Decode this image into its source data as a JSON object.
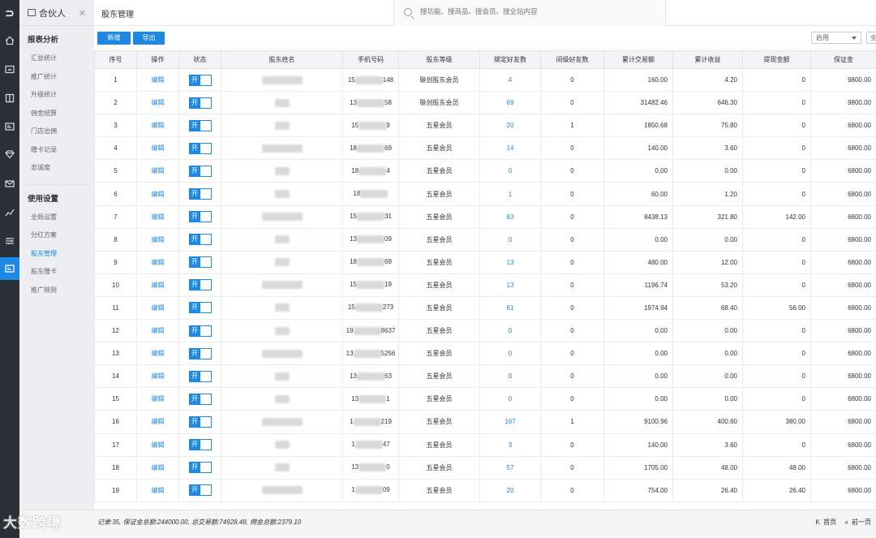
{
  "app": {
    "module_title": "合伙人",
    "page_title": "股东管理"
  },
  "rail_icons": [
    "home-icon",
    "monitor-icon",
    "book-icon",
    "id-card-icon",
    "diamond-icon",
    "mail-icon",
    "trend-icon",
    "sliders-icon",
    "card-icon"
  ],
  "sidenav": {
    "group1": "报表分析",
    "group1_items": [
      "汇总统计",
      "推广统计",
      "升级统计",
      "佣金结算",
      "门店出佣",
      "赠卡记录",
      "忠诚度"
    ],
    "group2": "使用设置",
    "group2_items": [
      "全局设置",
      "分红方案",
      "股东管理",
      "股东赠卡",
      "推广规则"
    ],
    "active_item": "股东管理"
  },
  "search": {
    "placeholder": "搜功能、搜商品、搜会员、搜全站内容"
  },
  "toolbar": {
    "add_label": "新增",
    "export_label": "导出",
    "status_filter": "启用",
    "second_filter": "全"
  },
  "table": {
    "headers": [
      "序号",
      "操作",
      "状态",
      "股东姓名",
      "手机号码",
      "股东等级",
      "绑定好友数",
      "间级好友数",
      "累计交易额",
      "累计收益",
      "提现金额",
      "保证金"
    ],
    "edit_label": "编辑",
    "toggle_label": "开",
    "rows": [
      {
        "no": "1",
        "name": "",
        "phone_a": "15",
        "phone_b": "148",
        "level": "联创股东会员",
        "bound": "4",
        "indirect": "0",
        "trade": "160.00",
        "income": "4.20",
        "withdraw": "0",
        "deposit": "9800.00"
      },
      {
        "no": "2",
        "name": "",
        "phone_a": "13",
        "phone_b": "58",
        "level": "联创股东会员",
        "bound": "69",
        "indirect": "0",
        "trade": "31482.46",
        "income": "646.30",
        "withdraw": "0",
        "deposit": "9800.00"
      },
      {
        "no": "3",
        "name": "",
        "phone_a": "15",
        "phone_b": "9",
        "level": "五星会员",
        "bound": "20",
        "indirect": "1",
        "trade": "1850.68",
        "income": "75.80",
        "withdraw": "0",
        "deposit": "6800.00"
      },
      {
        "no": "4",
        "name": "",
        "phone_a": "18",
        "phone_b": "69",
        "level": "五星会员",
        "bound": "14",
        "indirect": "0",
        "trade": "140.00",
        "income": "3.60",
        "withdraw": "0",
        "deposit": "6800.00"
      },
      {
        "no": "5",
        "name": "",
        "phone_a": "18",
        "phone_b": "4",
        "level": "五星会员",
        "bound": "0",
        "indirect": "0",
        "trade": "0.00",
        "income": "0.00",
        "withdraw": "0",
        "deposit": "6800.00"
      },
      {
        "no": "6",
        "name": "",
        "phone_a": "18",
        "phone_b": "",
        "level": "五星会员",
        "bound": "1",
        "indirect": "0",
        "trade": "60.00",
        "income": "1.20",
        "withdraw": "0",
        "deposit": "6800.00"
      },
      {
        "no": "7",
        "name": "",
        "phone_a": "15",
        "phone_b": "31",
        "level": "五星会员",
        "bound": "83",
        "indirect": "0",
        "trade": "8438.13",
        "income": "321.80",
        "withdraw": "142.00",
        "deposit": "6800.00"
      },
      {
        "no": "8",
        "name": "",
        "phone_a": "13",
        "phone_b": "09",
        "level": "五星会员",
        "bound": "0",
        "indirect": "0",
        "trade": "0.00",
        "income": "0.00",
        "withdraw": "0",
        "deposit": "6800.00"
      },
      {
        "no": "9",
        "name": "",
        "phone_a": "18",
        "phone_b": "69",
        "level": "五星会员",
        "bound": "13",
        "indirect": "0",
        "trade": "480.00",
        "income": "12.00",
        "withdraw": "0",
        "deposit": "6800.00"
      },
      {
        "no": "10",
        "name": "",
        "phone_a": "15",
        "phone_b": "19",
        "level": "五星会员",
        "bound": "13",
        "indirect": "0",
        "trade": "1196.74",
        "income": "53.20",
        "withdraw": "0",
        "deposit": "6800.00"
      },
      {
        "no": "11",
        "name": "",
        "phone_a": "15",
        "phone_b": "273",
        "level": "五星会员",
        "bound": "61",
        "indirect": "0",
        "trade": "1974.94",
        "income": "68.40",
        "withdraw": "56.00",
        "deposit": "6800.00"
      },
      {
        "no": "12",
        "name": "",
        "phone_a": "19",
        "phone_b": "8637",
        "level": "五星会员",
        "bound": "0",
        "indirect": "0",
        "trade": "0.00",
        "income": "0.00",
        "withdraw": "0",
        "deposit": "6800.00"
      },
      {
        "no": "13",
        "name": "",
        "phone_a": "13",
        "phone_b": "5256",
        "level": "五星会员",
        "bound": "0",
        "indirect": "0",
        "trade": "0.00",
        "income": "0.00",
        "withdraw": "0",
        "deposit": "6800.00"
      },
      {
        "no": "14",
        "name": "",
        "phone_a": "13",
        "phone_b": "63",
        "level": "五星会员",
        "bound": "0",
        "indirect": "0",
        "trade": "0.00",
        "income": "0.00",
        "withdraw": "0",
        "deposit": "6800.00"
      },
      {
        "no": "15",
        "name": "",
        "phone_a": "13",
        "phone_b": "1",
        "level": "五星会员",
        "bound": "0",
        "indirect": "0",
        "trade": "0.00",
        "income": "0.00",
        "withdraw": "0",
        "deposit": "6800.00"
      },
      {
        "no": "16",
        "name": "",
        "phone_a": "1",
        "phone_b": "219",
        "level": "五星会员",
        "bound": "167",
        "indirect": "1",
        "trade": "9100.96",
        "income": "400.60",
        "withdraw": "380.00",
        "deposit": "6800.00"
      },
      {
        "no": "17",
        "name": "",
        "phone_a": "1",
        "phone_b": "47",
        "level": "五星会员",
        "bound": "3",
        "indirect": "0",
        "trade": "140.00",
        "income": "3.60",
        "withdraw": "0",
        "deposit": "6800.00"
      },
      {
        "no": "18",
        "name": "",
        "phone_a": "13",
        "phone_b": "0",
        "level": "五星会员",
        "bound": "57",
        "indirect": "0",
        "trade": "1705.00",
        "income": "48.00",
        "withdraw": "48.00",
        "deposit": "6800.00"
      },
      {
        "no": "19",
        "name": "",
        "phone_a": "1",
        "phone_b": "09",
        "level": "五星会员",
        "bound": "20",
        "indirect": "0",
        "trade": "754.00",
        "income": "26.40",
        "withdraw": "26.40",
        "deposit": "6800.00"
      }
    ]
  },
  "footer": {
    "summary": "记录:35, 保证金总额:244000.00, 总交易额:74928.48, 佣金总额:2379.10",
    "first_page": "首页",
    "prev_page": "前一页"
  },
  "watermark": "大数跨境"
}
